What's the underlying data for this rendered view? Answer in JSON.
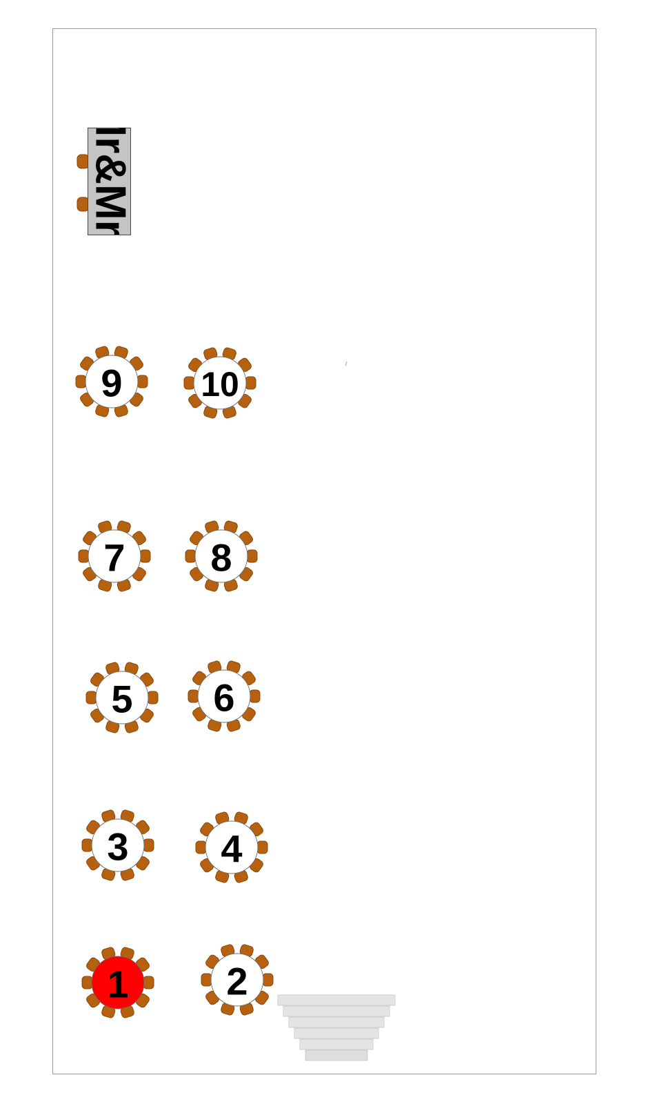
{
  "colors": {
    "chair": "#b5610f",
    "chair_edge": "#8a470b",
    "table_fill": "#ffffff",
    "vip_table_fill": "#ff0000",
    "head_table_fill": "#c4c4c4",
    "border": "#9a9a9a",
    "stairs": "#e4e4e4",
    "text": "#000000"
  },
  "head_table": {
    "label": "Mr&Mrs",
    "chairs": 2
  },
  "tables": [
    {
      "number": "9",
      "chairs": 10,
      "highlight": false
    },
    {
      "number": "10",
      "chairs": 10,
      "highlight": false
    },
    {
      "number": "7",
      "chairs": 10,
      "highlight": false
    },
    {
      "number": "8",
      "chairs": 10,
      "highlight": false
    },
    {
      "number": "5",
      "chairs": 10,
      "highlight": false
    },
    {
      "number": "6",
      "chairs": 10,
      "highlight": false
    },
    {
      "number": "3",
      "chairs": 10,
      "highlight": false
    },
    {
      "number": "4",
      "chairs": 10,
      "highlight": false
    },
    {
      "number": "1",
      "chairs": 10,
      "highlight": true
    },
    {
      "number": "2",
      "chairs": 10,
      "highlight": false
    }
  ],
  "stairs": {
    "icon": "stairs-icon",
    "steps": 6
  }
}
